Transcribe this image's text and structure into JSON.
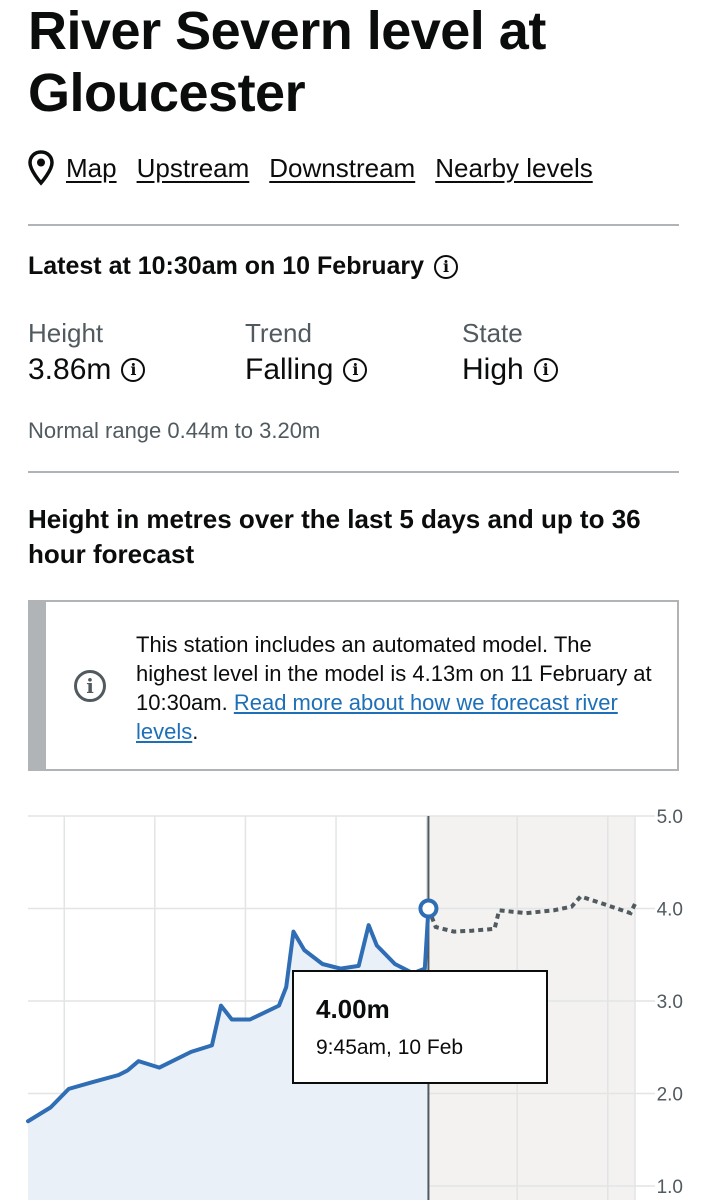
{
  "page": {
    "title": "River Severn level at Gloucester"
  },
  "nav": {
    "links": [
      "Map",
      "Upstream",
      "Downstream",
      "Nearby levels"
    ]
  },
  "latest": {
    "heading": "Latest at 10:30am on 10 February",
    "stats": [
      {
        "label": "Height",
        "value": "3.86m"
      },
      {
        "label": "Trend",
        "value": "Falling"
      },
      {
        "label": "State",
        "value": "High"
      }
    ],
    "normal_range": "Normal range 0.44m to 3.20m"
  },
  "chart_heading": "Height in metres over the last 5 days and up to 36 hour forecast",
  "notice": {
    "text": "This station includes an automated model. The highest level in the model is 4.13m on 11 February at 10:30am. ",
    "link": "Read more about how we forecast river levels",
    "trailing": "."
  },
  "tooltip": {
    "value": "4.00m",
    "time": "9:45am, 10 Feb"
  },
  "colors": {
    "observed_line": "#2f6db5",
    "observed_fill": "#eaf0f8",
    "forecast_line": "#505a5f",
    "forecast_fill": "#f3f2f1",
    "grid": "#e3e4e5"
  },
  "chart_data": {
    "type": "line",
    "title": "",
    "xlabel": "",
    "ylabel": "",
    "ylim": [
      1.0,
      5.0
    ],
    "y_ticks": [
      "1.0",
      "2.0",
      "3.0",
      "4.0",
      "5.0"
    ],
    "y_axis_position": "right",
    "grid": true,
    "series": [
      {
        "style": "solid",
        "points": [
          [
            0.0,
            1.7
          ],
          [
            0.25,
            1.85
          ],
          [
            0.45,
            2.05
          ],
          [
            0.7,
            2.12
          ],
          [
            1.0,
            2.2
          ],
          [
            1.1,
            2.25
          ],
          [
            1.22,
            2.35
          ],
          [
            1.45,
            2.28
          ],
          [
            1.8,
            2.45
          ],
          [
            2.03,
            2.52
          ],
          [
            2.13,
            2.95
          ],
          [
            2.25,
            2.8
          ],
          [
            2.45,
            2.8
          ],
          [
            2.77,
            2.95
          ],
          [
            2.85,
            3.15
          ],
          [
            2.93,
            3.75
          ],
          [
            3.05,
            3.55
          ],
          [
            3.25,
            3.4
          ],
          [
            3.45,
            3.35
          ],
          [
            3.65,
            3.38
          ],
          [
            3.76,
            3.82
          ],
          [
            3.85,
            3.6
          ],
          [
            4.05,
            3.4
          ],
          [
            4.25,
            3.3
          ],
          [
            4.38,
            3.35
          ],
          [
            4.42,
            4.0
          ]
        ]
      },
      {
        "style": "dashed",
        "points": [
          [
            4.42,
            4.0
          ],
          [
            4.5,
            3.8
          ],
          [
            4.7,
            3.75
          ],
          [
            4.9,
            3.76
          ],
          [
            5.15,
            3.78
          ],
          [
            5.2,
            3.98
          ],
          [
            5.5,
            3.95
          ],
          [
            5.8,
            3.98
          ],
          [
            6.0,
            4.02
          ],
          [
            6.1,
            4.13
          ],
          [
            6.35,
            4.05
          ],
          [
            6.65,
            3.95
          ],
          [
            6.7,
            4.05
          ]
        ]
      }
    ],
    "highlight": {
      "x": 4.42,
      "y": 4.0
    }
  }
}
